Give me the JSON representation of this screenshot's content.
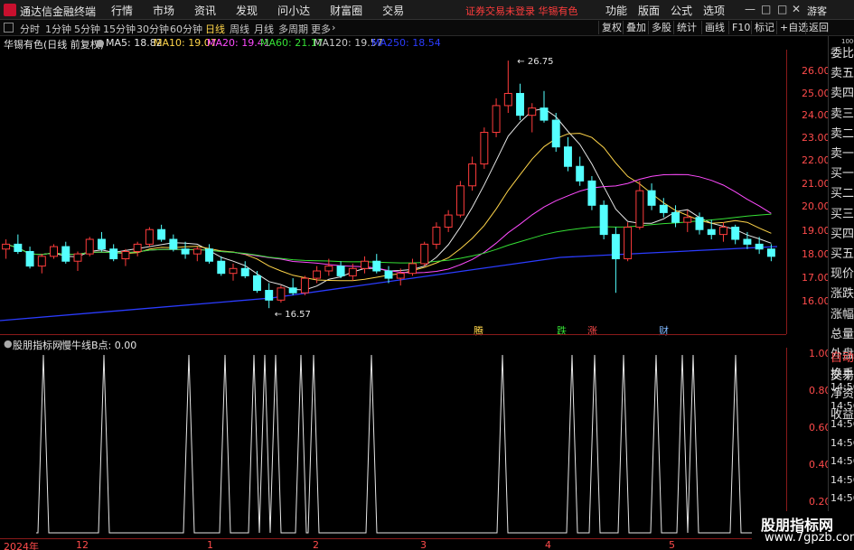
{
  "titlebar": {
    "app_title": "通达信金融终端",
    "menu": [
      "行情",
      "市场",
      "资讯",
      "发现",
      "问小达",
      "财富圈",
      "交易"
    ],
    "notice": "证券交易未登录  华锡有色",
    "right_menu": [
      "功能",
      "版面",
      "公式",
      "选项"
    ],
    "guest": "游客"
  },
  "toolbar": {
    "timeframes": [
      "分时",
      "1分钟",
      "5分钟",
      "15分钟",
      "30分钟",
      "60分钟",
      "日线",
      "周线",
      "月线",
      "多周期",
      "更多"
    ],
    "active": "日线",
    "right_buttons": [
      "复权",
      "叠加",
      "多股",
      "统计",
      "画线",
      "F10",
      "标记",
      "+自选",
      "返回"
    ]
  },
  "indicators": {
    "name": "华锡有色(日线 前复权)",
    "ma5": "MA5: 18.82",
    "ma10": "MA10: 19.07",
    "ma20": "MA20: 19.41",
    "ma60": "MA60: 21.17",
    "ma120": "MA120: 19.57",
    "ma250": "MA250: 18.54",
    "colors": {
      "ma5": "#e6e6e6",
      "ma10": "#ffd54a",
      "ma20": "#ff4bff",
      "ma60": "#35e035",
      "ma120": "#c8c8c8",
      "ma250": "#2b3cff"
    }
  },
  "price_axis": [
    "26.00",
    "25.00",
    "24.00",
    "23.00",
    "22.00",
    "21.00",
    "20.00",
    "19.00",
    "18.00",
    "17.00",
    "16.00"
  ],
  "annotations": {
    "high": "26.75",
    "low": "16.57"
  },
  "event_labels": [
    "腾",
    "跌",
    "涨",
    "财"
  ],
  "side_panel": [
    "委比",
    "卖五",
    "卖四",
    "卖三",
    "卖二",
    "卖一",
    "买一",
    "买二",
    "买三",
    "买四",
    "买五",
    "现价",
    "涨跌",
    "涨幅",
    "总量",
    "外盘",
    "换手",
    "净资",
    "收益",
    "自动",
    "交易",
    "14:56",
    "14:56",
    "14:56",
    "14:56",
    "14:56",
    "14:56",
    "14:56"
  ],
  "side_top_label": "1000",
  "lower": {
    "label_name": "股朋指标网",
    "label_value": "慢牛线B点: 0.00",
    "axis": [
      "1.00",
      "0.80",
      "0.60",
      "0.40",
      "0.20"
    ]
  },
  "time_axis": [
    "2024年",
    "12",
    "1",
    "2",
    "3",
    "4",
    "5"
  ],
  "watermark": {
    "line1": "股朋指标网",
    "line2": "www.7gpzb.com"
  },
  "chart_data": {
    "type": "candlestick",
    "ylim": [
      15.5,
      27.2
    ],
    "candles": [
      [
        19.0,
        19.4,
        18.6,
        19.2
      ],
      [
        19.2,
        19.6,
        18.8,
        18.9
      ],
      [
        18.9,
        19.1,
        18.2,
        18.3
      ],
      [
        18.3,
        18.8,
        18.0,
        18.7
      ],
      [
        18.7,
        19.2,
        18.6,
        19.1
      ],
      [
        19.1,
        19.3,
        18.4,
        18.5
      ],
      [
        18.5,
        18.9,
        18.1,
        18.8
      ],
      [
        18.8,
        19.5,
        18.7,
        19.4
      ],
      [
        19.4,
        19.7,
        18.9,
        19.0
      ],
      [
        19.0,
        19.2,
        18.5,
        18.6
      ],
      [
        18.6,
        19.0,
        18.3,
        18.9
      ],
      [
        18.9,
        19.3,
        18.7,
        19.2
      ],
      [
        19.2,
        19.9,
        19.1,
        19.8
      ],
      [
        19.8,
        20.0,
        19.3,
        19.4
      ],
      [
        19.4,
        19.6,
        18.9,
        19.0
      ],
      [
        19.0,
        19.3,
        18.6,
        18.8
      ],
      [
        18.8,
        19.1,
        18.5,
        19.0
      ],
      [
        19.0,
        19.2,
        18.4,
        18.5
      ],
      [
        18.5,
        18.7,
        17.9,
        18.0
      ],
      [
        18.0,
        18.4,
        17.7,
        18.2
      ],
      [
        18.2,
        18.5,
        17.8,
        17.9
      ],
      [
        17.9,
        18.1,
        17.2,
        17.3
      ],
      [
        17.3,
        17.6,
        16.57,
        16.9
      ],
      [
        16.9,
        17.5,
        16.8,
        17.4
      ],
      [
        17.4,
        17.8,
        17.1,
        17.2
      ],
      [
        17.2,
        17.9,
        17.1,
        17.8
      ],
      [
        17.8,
        18.3,
        17.6,
        18.1
      ],
      [
        18.1,
        18.6,
        17.9,
        18.3
      ],
      [
        18.3,
        18.5,
        17.8,
        17.9
      ],
      [
        17.9,
        18.4,
        17.7,
        18.2
      ],
      [
        18.2,
        18.7,
        18.0,
        18.5
      ],
      [
        18.5,
        18.8,
        18.0,
        18.1
      ],
      [
        18.1,
        18.3,
        17.6,
        17.8
      ],
      [
        17.8,
        18.2,
        17.5,
        18.0
      ],
      [
        18.0,
        18.6,
        17.9,
        18.4
      ],
      [
        18.4,
        19.3,
        18.3,
        19.2
      ],
      [
        19.2,
        20.1,
        19.0,
        19.9
      ],
      [
        19.9,
        20.6,
        19.7,
        20.4
      ],
      [
        20.4,
        21.8,
        20.3,
        21.6
      ],
      [
        21.6,
        22.8,
        21.4,
        22.5
      ],
      [
        22.5,
        24.0,
        22.3,
        23.8
      ],
      [
        23.8,
        25.2,
        23.6,
        24.9
      ],
      [
        24.9,
        26.75,
        24.6,
        25.4
      ],
      [
        25.4,
        25.8,
        24.3,
        24.5
      ],
      [
        24.5,
        25.0,
        23.8,
        24.8
      ],
      [
        24.8,
        25.5,
        24.2,
        24.3
      ],
      [
        24.3,
        24.6,
        23.0,
        23.2
      ],
      [
        23.2,
        23.6,
        22.2,
        22.4
      ],
      [
        22.4,
        22.8,
        21.6,
        21.8
      ],
      [
        21.8,
        22.0,
        20.6,
        20.8
      ],
      [
        20.8,
        21.0,
        19.4,
        19.6
      ],
      [
        19.6,
        19.9,
        17.2,
        18.6
      ],
      [
        18.6,
        20.1,
        18.5,
        19.9
      ],
      [
        19.9,
        21.8,
        19.8,
        21.4
      ],
      [
        21.4,
        21.7,
        20.6,
        20.8
      ],
      [
        20.8,
        21.1,
        20.3,
        20.5
      ],
      [
        20.5,
        20.8,
        19.9,
        20.1
      ],
      [
        20.1,
        20.6,
        19.7,
        20.3
      ],
      [
        20.3,
        20.5,
        19.6,
        19.8
      ],
      [
        19.8,
        20.2,
        19.4,
        19.6
      ],
      [
        19.6,
        20.1,
        19.3,
        19.9
      ],
      [
        19.9,
        20.0,
        19.2,
        19.4
      ],
      [
        19.4,
        19.7,
        19.0,
        19.2
      ],
      [
        19.2,
        19.5,
        18.8,
        19.0
      ],
      [
        19.0,
        19.2,
        18.5,
        18.7
      ]
    ],
    "signal_positions": [
      48,
      115,
      209,
      249,
      281,
      293,
      305,
      333,
      347,
      411,
      556,
      633,
      658,
      690,
      726,
      755,
      767,
      814
    ],
    "signal_value_range": [
      0,
      1
    ]
  }
}
